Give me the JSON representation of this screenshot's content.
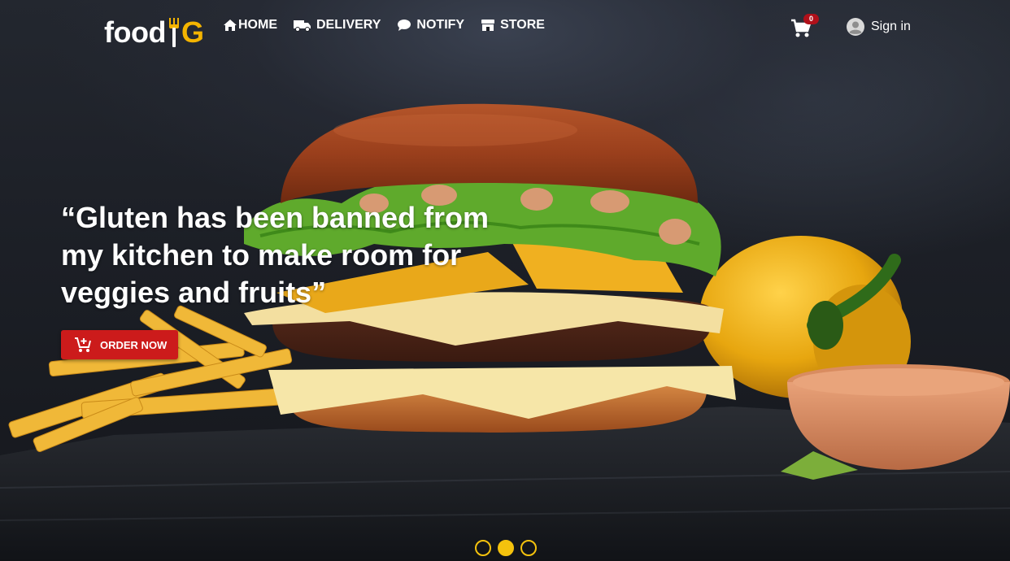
{
  "brand": {
    "logo_text": "food",
    "logo_accent": "G",
    "accent_color": "#f4b400"
  },
  "nav": {
    "items": [
      {
        "label": "HOME",
        "icon": "home-icon"
      },
      {
        "label": "DELIVERY",
        "icon": "truck-icon"
      },
      {
        "label": "NOTIFY",
        "icon": "chat-bubble-icon"
      },
      {
        "label": "STORE",
        "icon": "store-icon"
      }
    ],
    "cart": {
      "icon": "cart-icon",
      "count": "0"
    },
    "signin": {
      "label": "Sign in",
      "icon": "user-avatar-icon"
    }
  },
  "hero": {
    "headline_line1": "“Gluten has been banned from",
    "headline_line2": "my kitchen to make room for",
    "headline_line3": "veggies and fruits”",
    "cta_label": "ORDER NOW",
    "cta_icon": "add-to-cart-icon",
    "cta_color": "#cc1b1b",
    "image_subject": "burger with fries, yellow pepper and dipping sauce"
  },
  "carousel": {
    "slides": 3,
    "active_index": 1,
    "dot_color": "#f4c20d"
  }
}
